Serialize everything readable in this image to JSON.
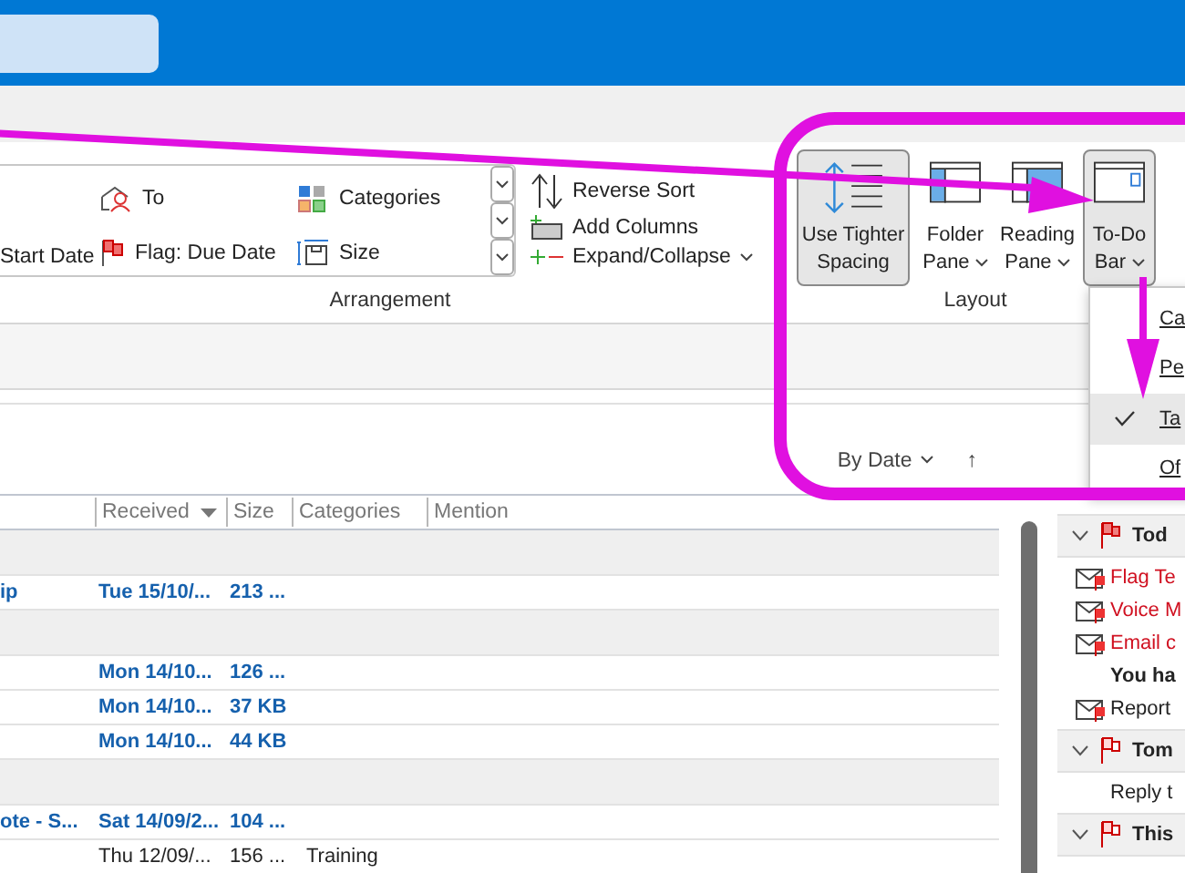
{
  "ribbon": {
    "gallery": [
      {
        "kind": "recipient",
        "label": "To"
      },
      {
        "kind": "categories",
        "label": "Categories"
      },
      {
        "kind": "date",
        "label": "Start Date"
      },
      {
        "kind": "flag",
        "label": "Flag: Due Date"
      },
      {
        "kind": "size",
        "label": "Size"
      }
    ],
    "commands": [
      {
        "kind": "reverse",
        "label": "Reverse Sort"
      },
      {
        "kind": "columns",
        "label": "Add Columns"
      },
      {
        "kind": "expand",
        "label": "Expand/Collapse",
        "dropdown": true
      }
    ],
    "arrangement_label": "Arrangement",
    "layout_buttons": [
      {
        "kind": "spacing",
        "lines": [
          "Use Tighter",
          "Spacing"
        ],
        "selected": true,
        "dropdown": false
      },
      {
        "kind": "folder",
        "lines": [
          "Folder",
          "Pane"
        ],
        "selected": false,
        "dropdown": true
      },
      {
        "kind": "reading",
        "lines": [
          "Reading",
          "Pane"
        ],
        "selected": false,
        "dropdown": true
      },
      {
        "kind": "todo",
        "lines": [
          "To-Do",
          "Bar"
        ],
        "selected": true,
        "dropdown": true
      }
    ],
    "layout_label": "Layout"
  },
  "todo_menu": [
    {
      "label": "Ca",
      "checked": false,
      "selected": false
    },
    {
      "label": "Pe",
      "checked": false,
      "selected": false
    },
    {
      "label": "Ta",
      "checked": true,
      "selected": true
    },
    {
      "label": "Of",
      "checked": false,
      "selected": false
    }
  ],
  "mail_list": {
    "sort": "By Date",
    "sort_direction": "↑",
    "columns": [
      "Received",
      "Size",
      "Categories",
      "Mention"
    ],
    "rows": [
      {
        "kind": "group"
      },
      {
        "kind": "message",
        "unread": true,
        "cells": [
          "ip",
          "Tue 15/10/...",
          "213 ...",
          ""
        ]
      },
      {
        "kind": "group"
      },
      {
        "kind": "message",
        "unread": true,
        "cells": [
          "",
          "Mon 14/10...",
          "126 ...",
          ""
        ]
      },
      {
        "kind": "message",
        "unread": true,
        "cells": [
          "",
          "Mon 14/10...",
          "37 KB",
          ""
        ]
      },
      {
        "kind": "message",
        "unread": true,
        "cells": [
          "",
          "Mon 14/10...",
          "44 KB",
          ""
        ]
      },
      {
        "kind": "group"
      },
      {
        "kind": "message",
        "unread": true,
        "cells": [
          "ote - S...",
          "Sat 14/09/2...",
          "104 ...",
          ""
        ]
      },
      {
        "kind": "message",
        "unread": false,
        "cells": [
          "",
          "Thu 12/09/...",
          "156 ...",
          "Training"
        ]
      }
    ]
  },
  "todo_bar": [
    {
      "kind": "header",
      "label": "Tod",
      "expanded": true
    },
    {
      "kind": "mail",
      "label": "Flag Te",
      "overdue": true
    },
    {
      "kind": "mail",
      "label": "Voice M",
      "overdue": true
    },
    {
      "kind": "mail",
      "label": "Email c",
      "overdue": true
    },
    {
      "kind": "line",
      "label": "You ha",
      "bold": true
    },
    {
      "kind": "mail",
      "label": "Report",
      "overdue": false
    },
    {
      "kind": "header",
      "label": "Tom",
      "expanded": true
    },
    {
      "kind": "line",
      "label": "Reply t",
      "bold": false
    },
    {
      "kind": "header",
      "label": "This",
      "expanded": true
    }
  ],
  "annotations": [
    {
      "kind": "frame",
      "color": "#e010e0"
    },
    {
      "kind": "arrow",
      "color": "#e010e0"
    },
    {
      "kind": "arrow",
      "color": "#e010e0"
    }
  ]
}
